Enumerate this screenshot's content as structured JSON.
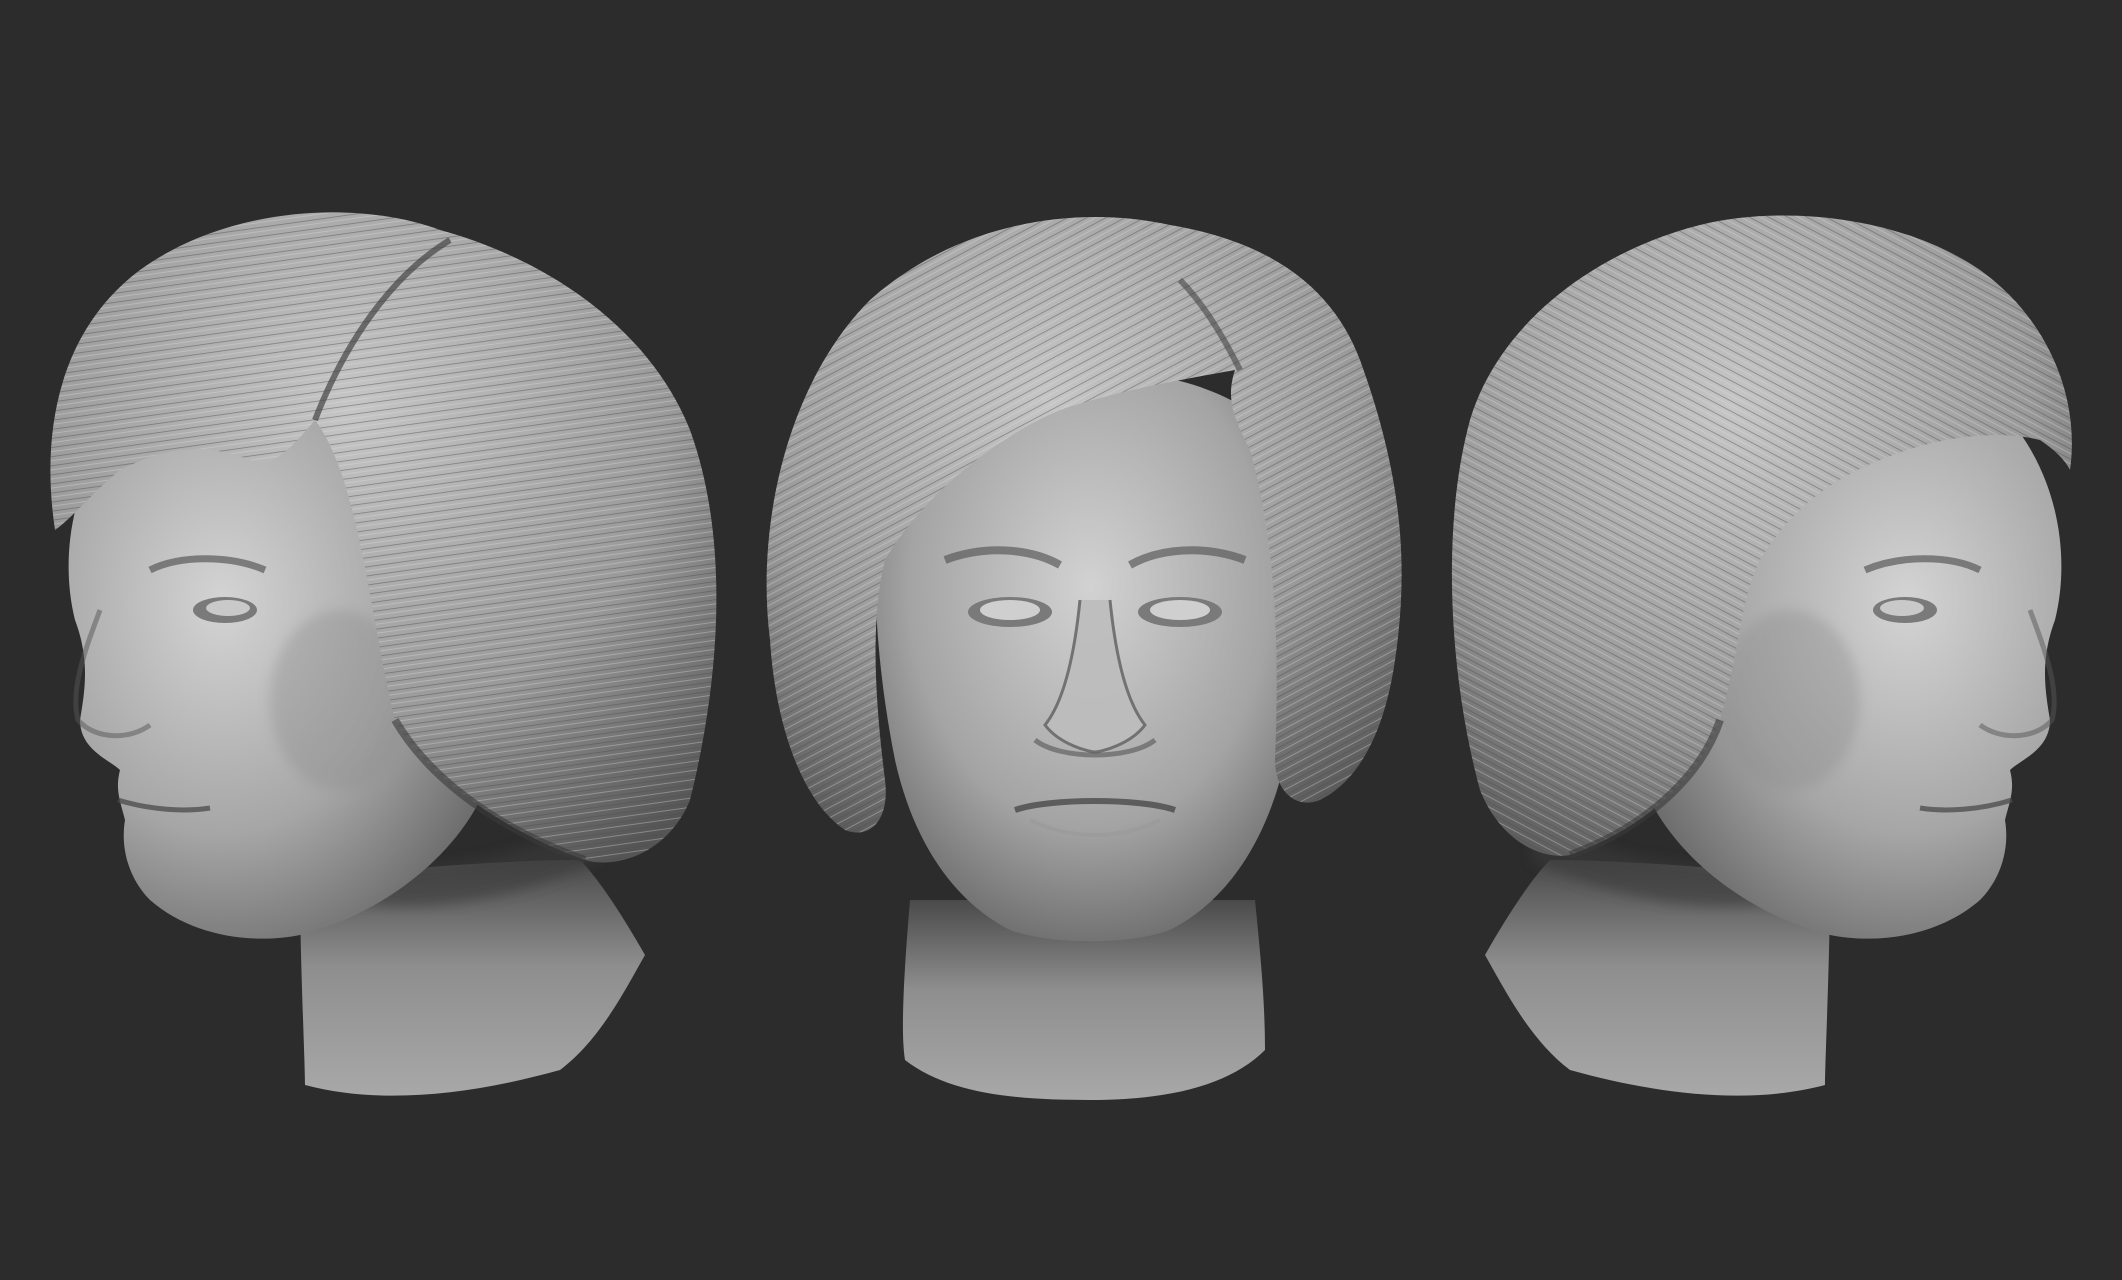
{
  "scene": {
    "background_color": "#2c2c2c",
    "material_color": "#9a9a9a",
    "views": [
      {
        "name": "left-three-quarter-view",
        "facing": "left"
      },
      {
        "name": "front-view",
        "facing": "front"
      },
      {
        "name": "right-three-quarter-view",
        "facing": "right"
      }
    ]
  }
}
